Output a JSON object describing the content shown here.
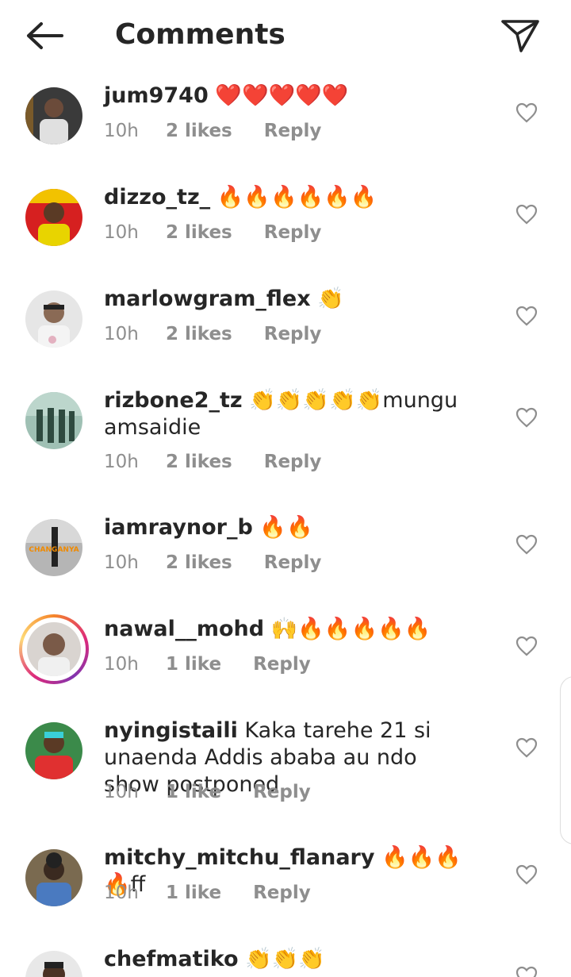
{
  "header": {
    "title": "Comments",
    "back_icon": "arrow-left-icon",
    "share_icon": "paper-plane-icon"
  },
  "comments": [
    {
      "username": "jum9740",
      "text": " ❤️❤️❤️❤️❤️",
      "time": "10h",
      "likes": "2 likes",
      "reply": "Reply",
      "avatar_color": "#2a2a2a"
    },
    {
      "username": "dizzo_tz_",
      "text": " 🔥🔥🔥🔥🔥🔥",
      "time": "10h",
      "likes": "2 likes",
      "reply": "Reply",
      "avatar_color": "#e8b400"
    },
    {
      "username": "marlowgram_flex",
      "text": " 👏",
      "time": "10h",
      "likes": "2 likes",
      "reply": "Reply",
      "avatar_color": "#cfcfcf"
    },
    {
      "username": "rizbone2_tz",
      "text": " 👏👏👏👏👏mungu amsaidie",
      "time": "10h",
      "likes": "2 likes",
      "reply": "Reply",
      "avatar_color": "#5f8a78"
    },
    {
      "username": "iamraynor_b",
      "text": " 🔥🔥",
      "time": "10h",
      "likes": "2 likes",
      "reply": "Reply",
      "avatar_color": "#9a9a9a"
    },
    {
      "username": "nawal__mohd",
      "text": " 🙌🔥🔥🔥🔥🔥",
      "time": "10h",
      "likes": "1 like",
      "reply": "Reply",
      "avatar_color": "#c9c3c0"
    },
    {
      "username": "nyingistaili",
      "text": " Kaka tarehe 21 si unaenda Addis ababa au ndo show postponed",
      "time": "10h",
      "likes": "1 like",
      "reply": "Reply",
      "avatar_color": "#2f6b3c"
    },
    {
      "username": "mitchy_mitchu_flanary",
      "text": " 🔥🔥🔥🔥ff",
      "time": "10h",
      "likes": "1 like",
      "reply": "Reply",
      "avatar_color": "#4a6fa0"
    },
    {
      "username": "chefmatiko",
      "text": " 👏👏👏",
      "time": "",
      "likes": "",
      "reply": "",
      "avatar_color": "#5a5a5a"
    }
  ],
  "avatar_overlay_text": "CHANGANYA",
  "colors": {
    "text": "#262626",
    "muted": "#8e8e8e",
    "story_ring_start": "#f58529",
    "story_ring_end": "#dd2a7b"
  }
}
